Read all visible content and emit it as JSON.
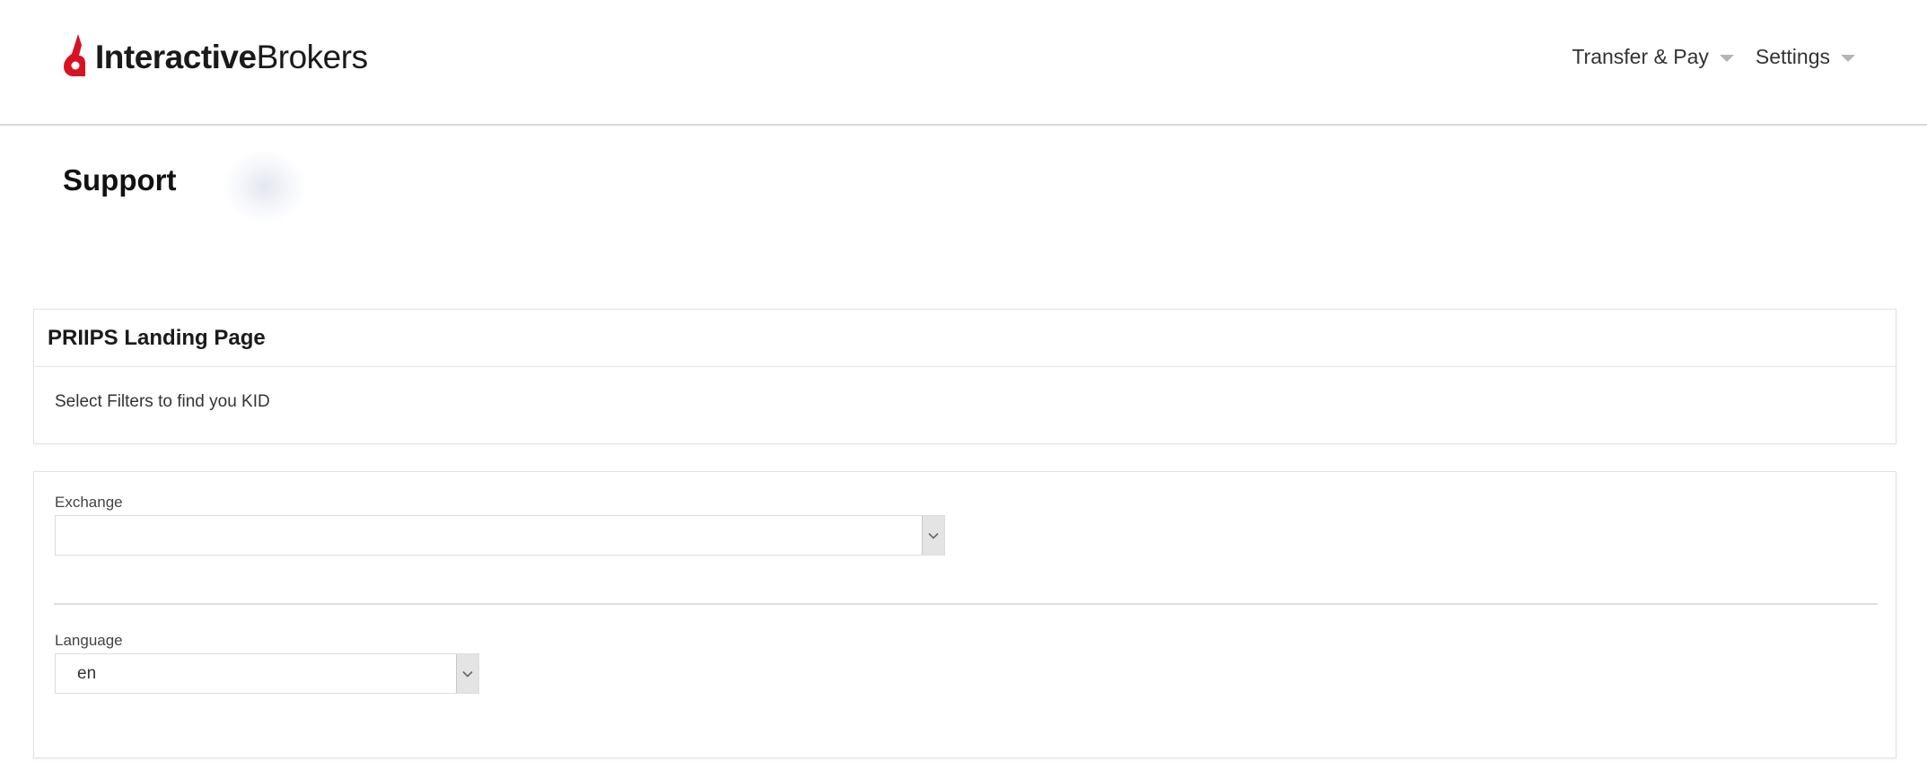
{
  "header": {
    "logo_bold": "Interactive",
    "logo_light": "Brokers",
    "nav": [
      {
        "label": "Transfer & Pay"
      },
      {
        "label": "Settings"
      }
    ]
  },
  "page": {
    "title": "Support"
  },
  "landing_panel": {
    "title": "PRIIPS Landing Page",
    "subtitle": "Select Filters to find you KID"
  },
  "filters": {
    "exchange": {
      "label": "Exchange",
      "value": ""
    },
    "language": {
      "label": "Language",
      "value": "en"
    }
  },
  "colors": {
    "brand_red": "#d81222",
    "caret_gray": "#b5b5b5"
  },
  "icons": {
    "logo": "ib-logo-icon",
    "nav_dropdown": "caret-down-icon",
    "select_dropdown": "chevron-down-icon"
  }
}
